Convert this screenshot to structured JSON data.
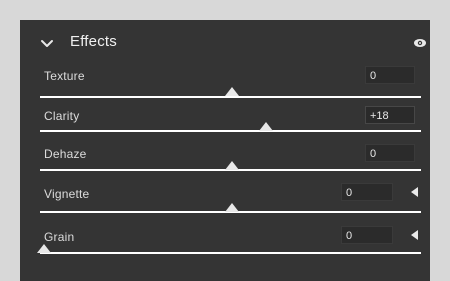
{
  "section": {
    "title": "Effects",
    "chevron_icon": "chevron-down-icon",
    "visibility_icon": "eye-icon"
  },
  "controls": [
    {
      "label": "Texture",
      "value": "0"
    },
    {
      "label": "Clarity",
      "value": "+18"
    },
    {
      "label": "Dehaze",
      "value": "0"
    },
    {
      "label": "Vignette",
      "value": "0"
    },
    {
      "label": "Grain",
      "value": "0"
    }
  ],
  "colors": {
    "panel_bg": "#343434",
    "outer_bg": "#d8d8d8",
    "text": "#e6e6e6",
    "track": "#5a5a5a",
    "thumb": "#e8e8e8"
  }
}
